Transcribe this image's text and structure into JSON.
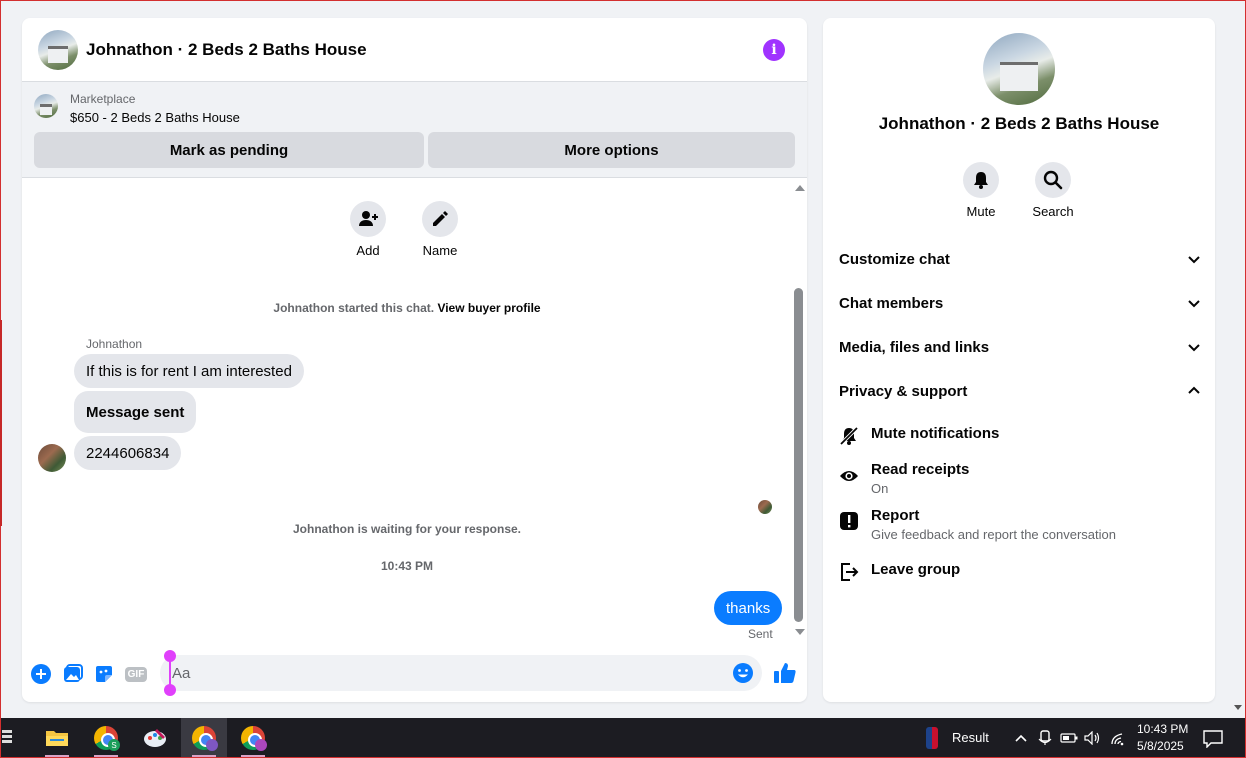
{
  "chat": {
    "title": "Johnathon · 2 Beds 2 Baths House",
    "marketplace_label": "Marketplace",
    "marketplace_item": "$650 - 2 Beds 2 Baths House",
    "mark_pending_label": "Mark as pending",
    "more_options_label": "More options",
    "quick_actions": [
      {
        "label": "Add",
        "icon": "add-person-icon"
      },
      {
        "label": "Name",
        "icon": "pencil-icon"
      }
    ],
    "started_text": "Johnathon started this chat.",
    "view_profile_link": "View buyer profile",
    "sender_name": "Johnathon",
    "incoming_messages": [
      "If this is for rent I am interested",
      "Message sent",
      "2244606834"
    ],
    "waiting_text": "Johnathon is waiting for your response.",
    "timestamp": "10:43 PM",
    "outgoing_message": "thanks",
    "sent_status": "Sent",
    "composer_placeholder": "Aa",
    "gif_label": "GIF"
  },
  "info_panel": {
    "title": "Johnathon · 2 Beds 2 Baths House",
    "actions": [
      {
        "label": "Mute",
        "icon": "bell-icon"
      },
      {
        "label": "Search",
        "icon": "search-icon"
      }
    ],
    "sections": [
      {
        "label": "Customize chat",
        "expanded": false
      },
      {
        "label": "Chat members",
        "expanded": false
      },
      {
        "label": "Media, files and links",
        "expanded": false
      },
      {
        "label": "Privacy & support",
        "expanded": true
      }
    ],
    "privacy_items": [
      {
        "title": "Mute notifications",
        "desc": "",
        "icon": "bell-off-icon"
      },
      {
        "title": "Read receipts",
        "desc": "On",
        "icon": "eye-icon"
      },
      {
        "title": "Report",
        "desc": "Give feedback and report the conversation",
        "icon": "report-icon"
      },
      {
        "title": "Leave group",
        "desc": "",
        "icon": "leave-icon"
      }
    ]
  },
  "taskbar": {
    "news_label": "Result",
    "clock_time": "10:43 PM",
    "clock_date": "5/8/2025"
  },
  "colors": {
    "accent_blue": "#0a7cff",
    "info_purple": "#a033ff",
    "bubble_gray": "#e4e6eb"
  }
}
